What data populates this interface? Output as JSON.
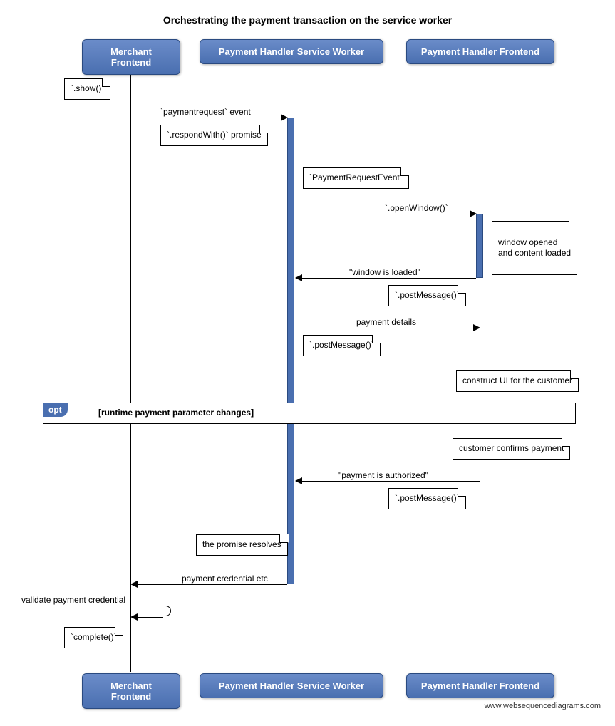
{
  "title": "Orchestrating the payment transaction on the service worker",
  "actors": {
    "merchant": "Merchant Frontend",
    "worker": "Payment Handler Service Worker",
    "frontend": "Payment Handler Frontend"
  },
  "notes": {
    "show": "`.show()`",
    "respondWith": "`.respondWith()` promise",
    "paymentRequestEvent": "`PaymentRequestEvent`",
    "windowOpened": "window opened\nand content loaded",
    "postMessage1": "`.postMessage()`",
    "postMessage2": "`.postMessage()`",
    "constructUI": "construct UI for the customer",
    "customerConfirms": "customer confirms payment",
    "postMessage3": "`.postMessage()`",
    "promiseResolves": "the promise resolves",
    "complete": "`complete()`"
  },
  "messages": {
    "paymentrequest": "`paymentrequest` event",
    "openWindow": "`.openWindow()`",
    "windowLoaded": "\"window is loaded\"",
    "paymentDetails": "payment details",
    "paymentAuthorized": "\"payment is authorized\"",
    "paymentCredential": "payment credential etc",
    "validate": "validate payment credential"
  },
  "opt": {
    "tag": "opt",
    "label": "[runtime payment parameter changes]"
  },
  "watermark": "www.websequencediagrams.com"
}
